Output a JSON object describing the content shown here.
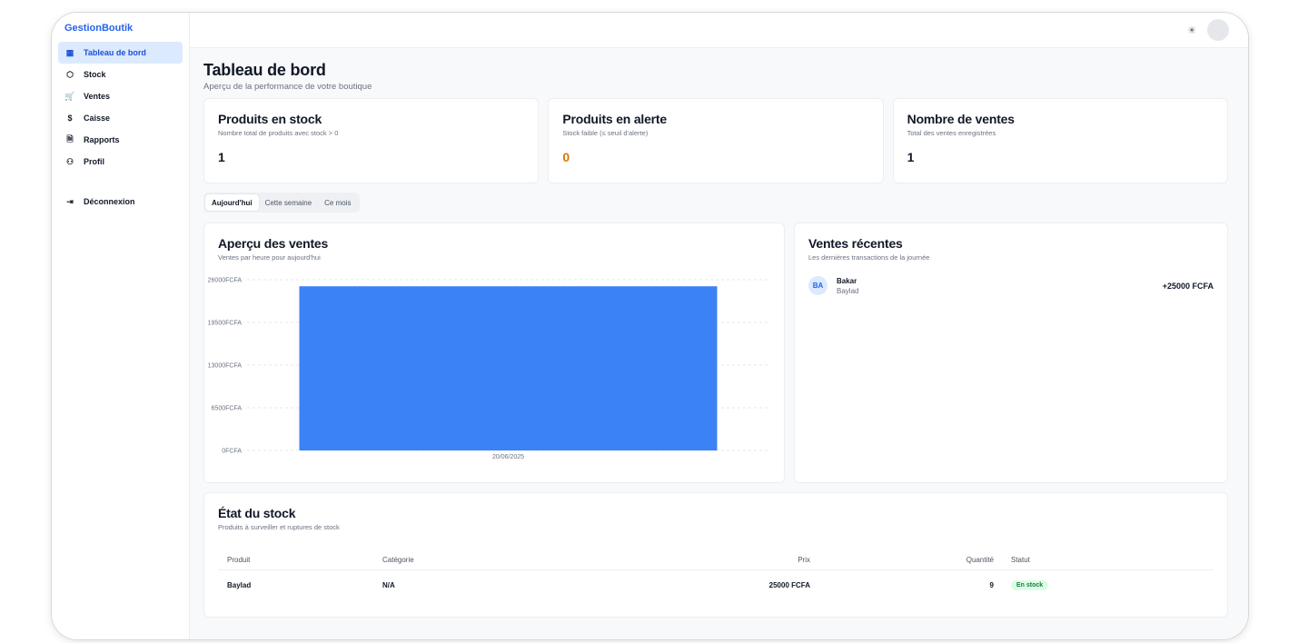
{
  "app": {
    "brand": "GestionBoutik"
  },
  "sidebar": {
    "items": [
      {
        "label": "Tableau de bord",
        "icon": "dashboard-icon",
        "glyph": "▦"
      },
      {
        "label": "Stock",
        "icon": "package-icon",
        "glyph": "⬡"
      },
      {
        "label": "Ventes",
        "icon": "cart-icon",
        "glyph": "🛒"
      },
      {
        "label": "Caisse",
        "icon": "dollar-icon",
        "glyph": "$"
      },
      {
        "label": "Rapports",
        "icon": "file-icon",
        "glyph": "🗎"
      },
      {
        "label": "Profil",
        "icon": "user-icon",
        "glyph": "⚇"
      }
    ],
    "logout": {
      "label": "Déconnexion",
      "icon": "logout-icon",
      "glyph": "⇥"
    }
  },
  "header": {
    "theme_glyph": "☀"
  },
  "page": {
    "title": "Tableau de bord",
    "subtitle": "Aperçu de la performance de votre boutique"
  },
  "stats": [
    {
      "title": "Produits en stock",
      "subtitle": "Nombre total de produits avec stock > 0",
      "value": "1"
    },
    {
      "title": "Produits en alerte",
      "subtitle": "Stock faible (≤ seuil d'alerte)",
      "value": "0"
    },
    {
      "title": "Nombre de ventes",
      "subtitle": "Total des ventes enregistrées",
      "value": "1"
    }
  ],
  "tabs": [
    "Aujourd'hui",
    "Cette semaine",
    "Ce mois"
  ],
  "sales_chart": {
    "title": "Aperçu des ventes",
    "subtitle": "Ventes par heure pour aujourd'hui"
  },
  "chart_data": {
    "type": "bar",
    "categories": [
      "20/06/2025"
    ],
    "values": [
      25000
    ],
    "ylim": [
      0,
      26000
    ],
    "ytick_values": [
      0,
      6500,
      13000,
      19500,
      26000
    ],
    "ytick_labels": [
      "0FCFA",
      "6500FCFA",
      "13000FCFA",
      "19500FCFA",
      "26000FCFA"
    ],
    "grid": true,
    "color": "#3b82f6"
  },
  "recent": {
    "title": "Ventes récentes",
    "subtitle": "Les dernières transactions de la journée",
    "items": [
      {
        "initials": "BA",
        "name": "Bakar",
        "sub": "Baylad",
        "amount": "+25000 FCFA"
      }
    ]
  },
  "stock": {
    "title": "État du stock",
    "subtitle": "Produits à surveiller et ruptures de stock",
    "columns": [
      "Produit",
      "Catégorie",
      "Prix",
      "Quantité",
      "Statut"
    ],
    "rows": [
      {
        "product": "Baylad",
        "category": "N/A",
        "price": "25000 FCFA",
        "qty": "9",
        "status": "En stock"
      }
    ]
  }
}
